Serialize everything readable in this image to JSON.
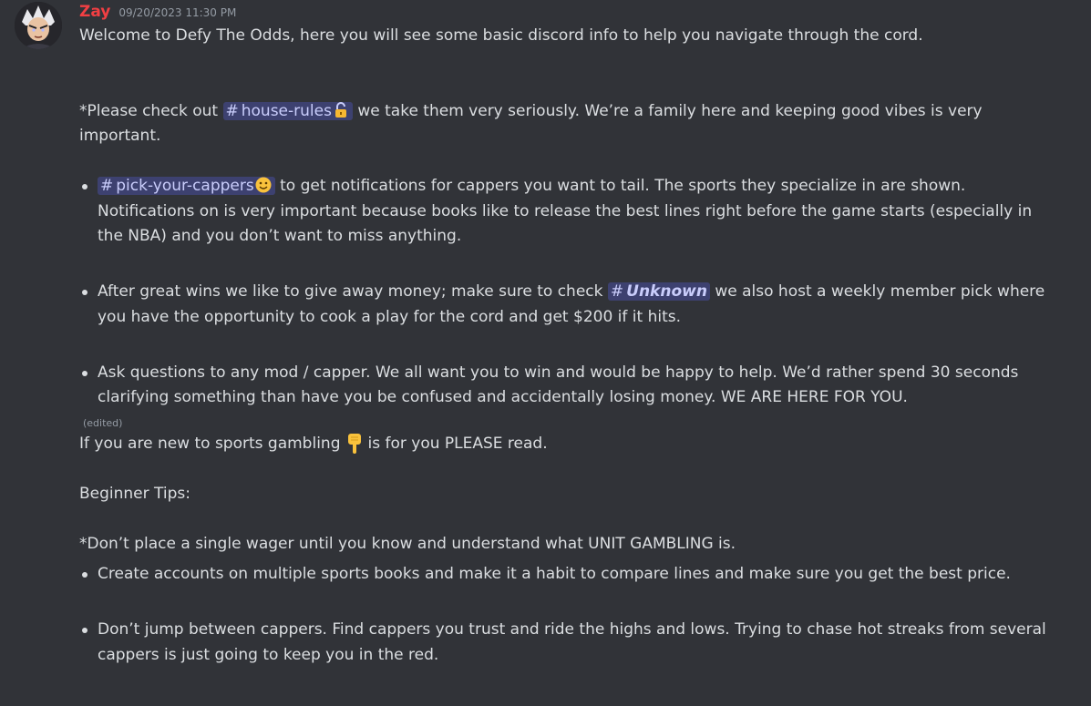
{
  "message": {
    "username": "Zay",
    "timestamp": "09/20/2023 11:30 PM",
    "intro": "Welcome to Defy The Odds, here you will see some basic discord info to help you navigate through the cord.",
    "house_rules": {
      "prefix": "*Please check out",
      "channel": "house-rules",
      "line1_rest": "we take them very seriously. We’re a family here and keeping good vibes is very",
      "line2": "important."
    },
    "bullets_1": [
      {
        "channel": "pick-your-cappers",
        "text_a": "to get notifications for cappers you want to tail. The sports they specialize in are shown.",
        "text_b": "Notifications on is very important because books like to release the best lines right before the game starts (especially in",
        "text_c": "the NBA) and you don’t want to miss anything."
      },
      {
        "prefix": "After great wins we like to give away money; make sure to check",
        "channel": "Unknown",
        "text_a": "we also host a weekly member pick where",
        "text_b": "you have the opportunity to cook a play for the cord and get $200 if it hits."
      },
      {
        "text_a": "Ask questions to any mod / capper. We all want you to win and would be happy to help. We’d rather spend 30 seconds",
        "text_b": "clarifying something than have you be confused and accidentally losing money. WE ARE HERE FOR YOU."
      }
    ],
    "edited_label": "(edited)",
    "new_gambler": {
      "before": "If you are new to sports gambling",
      "emoji": "pointing-down-emoji",
      "after": "is for you PLEASE read."
    },
    "tips_title": "Beginner Tips:",
    "unit_line": "*Don’t place a single wager until you know and understand what UNIT GAMBLING is.",
    "bullets_2": [
      {
        "text_a": "Create accounts on multiple sports books and make it a habit to compare lines and make sure you get the best price."
      },
      {
        "text_a": "Don’t jump between cappers. Find cappers you trust and ride the highs and lows. Trying to chase hot streaks from several",
        "text_b": "cappers is just going to keep you in the red."
      }
    ],
    "colors": {
      "background": "#313338",
      "username": "#f23f43",
      "mention_bg": "rgba(88,101,242,0.3)",
      "mention_text": "#c9cdfb",
      "text": "#dbdee1",
      "muted": "#949ba4"
    }
  }
}
